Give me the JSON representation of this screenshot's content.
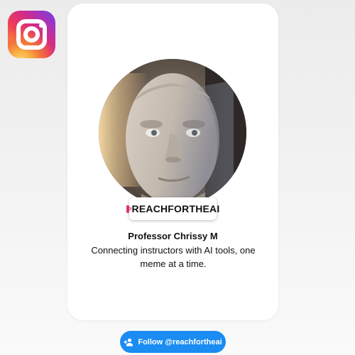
{
  "header": {
    "logo_icon": "instagram-logo-icon"
  },
  "profile": {
    "avatar_icon": "profile-photo-android-face",
    "handle_badge_icon": "instagram-glyph-icon",
    "handle_badge": "REACHFORTHEAI",
    "name": "Professor Chrissy M",
    "bio": "Connecting instructors with AI tools, one meme at a time."
  },
  "follow_button": {
    "icon": "add-person-icon",
    "label": "Follow @reachfortheai"
  },
  "colors": {
    "follow_button": "#1a8cf2",
    "card_background": "#ffffff",
    "page_background": "#f0f0f0",
    "instagram_pink": "#e1306c"
  }
}
